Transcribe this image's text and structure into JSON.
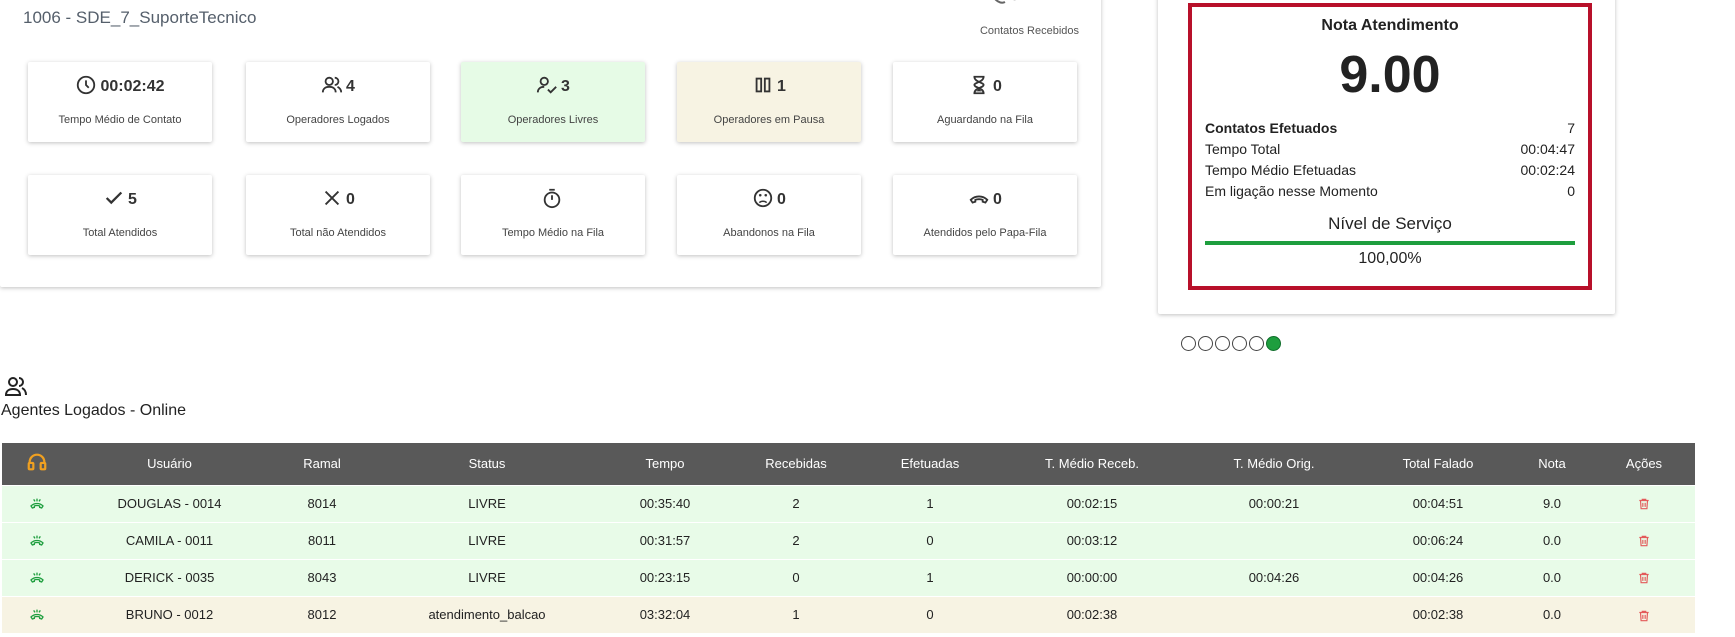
{
  "queue": {
    "title": "1006 - SDE_7_SuporteTecnico",
    "received_label": "Contatos Recebidos"
  },
  "cards": [
    {
      "icon": "clock-icon",
      "value": "00:02:42",
      "label": "Tempo Médio de Contato"
    },
    {
      "icon": "users-icon",
      "value": "4",
      "label": "Operadores Logados"
    },
    {
      "icon": "user-check-icon",
      "value": "3",
      "label": "Operadores Livres"
    },
    {
      "icon": "pause-icon",
      "value": "1",
      "label": "Operadores em Pausa"
    },
    {
      "icon": "hourglass-icon",
      "value": "0",
      "label": "Aguardando na Fila"
    },
    {
      "icon": "check-icon",
      "value": "5",
      "label": "Total Atendidos"
    },
    {
      "icon": "x-icon",
      "value": "0",
      "label": "Total não Atendidos"
    },
    {
      "icon": "stopwatch-icon",
      "value": "",
      "label": "Tempo Médio na Fila"
    },
    {
      "icon": "sad-face-icon",
      "value": "0",
      "label": "Abandonos na Fila"
    },
    {
      "icon": "phone-hangup-icon",
      "value": "0",
      "label": "Atendidos pelo Papa-Fila"
    }
  ],
  "nota": {
    "title": "Nota Atendimento",
    "score": "9.00",
    "rows": [
      {
        "key": "Contatos Efetuados",
        "value": "7"
      },
      {
        "key": "Tempo Total",
        "value": "00:04:47"
      },
      {
        "key": "Tempo Médio Efetuadas",
        "value": "00:02:24"
      },
      {
        "key": "Em ligação nesse Momento",
        "value": "0"
      }
    ],
    "nivel_title": "Nível de Serviço",
    "nivel_value": "100,00%",
    "nivel_fraction": 1.0
  },
  "carousel": {
    "count": 6,
    "active_index": 5
  },
  "agents": {
    "title": "Agentes Logados - Online",
    "columns": [
      "Usuário",
      "Ramal",
      "Status",
      "Tempo",
      "Recebidas",
      "Efetuadas",
      "T. Médio Receb.",
      "T. Médio Orig.",
      "Total Falado",
      "Nota",
      "Ações"
    ],
    "rows": [
      {
        "usuario": "DOUGLAS - 0014",
        "ramal": "8014",
        "status": "LIVRE",
        "tempo": "00:35:40",
        "recebidas": "2",
        "efetuadas": "1",
        "tmr": "00:02:15",
        "tmo": "00:00:21",
        "total": "00:04:51",
        "nota": "9.0"
      },
      {
        "usuario": "CAMILA - 0011",
        "ramal": "8011",
        "status": "LIVRE",
        "tempo": "00:31:57",
        "recebidas": "2",
        "efetuadas": "0",
        "tmr": "00:03:12",
        "tmo": "",
        "total": "00:06:24",
        "nota": "0.0"
      },
      {
        "usuario": "DERICK - 0035",
        "ramal": "8043",
        "status": "LIVRE",
        "tempo": "00:23:15",
        "recebidas": "0",
        "efetuadas": "1",
        "tmr": "00:00:00",
        "tmo": "00:04:26",
        "total": "00:04:26",
        "nota": "0.0"
      },
      {
        "usuario": "BRUNO - 0012",
        "ramal": "8012",
        "status": "atendimento_balcao",
        "tempo": "03:32:04",
        "recebidas": "1",
        "efetuadas": "0",
        "tmr": "00:02:38",
        "tmo": "",
        "total": "00:02:38",
        "nota": "0.0"
      }
    ]
  },
  "colors": {
    "accent_red": "#b8102a",
    "green": "#1e9e3e",
    "header_gray": "#595959",
    "orange": "#e8900f"
  }
}
